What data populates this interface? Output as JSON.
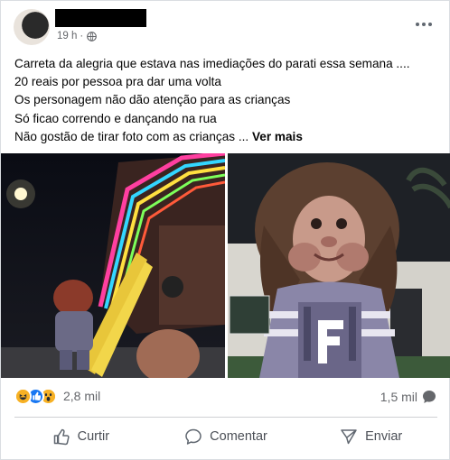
{
  "post": {
    "author_name": "",
    "timestamp": "19 h",
    "separator": "·",
    "privacy_icon": "globe-icon",
    "menu_icon": "more-horizontal-icon",
    "lines": [
      "Carreta da alegria que estava nas imediações do parati essa semana ....",
      "20 reais por pessoa pra dar uma volta",
      "Os personagem não dão atenção para as crianças",
      "Só ficao correndo e dançando na rua",
      "Não gostão de tirar foto com as crianças ..."
    ],
    "see_more": "Ver mais"
  },
  "photos": [
    {
      "name": "photo-left",
      "description_icon": "carnival-truck-photo"
    },
    {
      "name": "photo-right",
      "description_icon": "costume-character-photo"
    }
  ],
  "stats": {
    "reaction_icons": [
      "haha-icon",
      "like-icon",
      "wow-icon"
    ],
    "reaction_count": "2,8 mil",
    "comment_count": "1,5 mil",
    "comment_icon": "comment-bubble-icon"
  },
  "actions": [
    {
      "label": "Curtir",
      "icon": "thumbs-up-icon"
    },
    {
      "label": "Comentar",
      "icon": "comment-icon"
    },
    {
      "label": "Enviar",
      "icon": "send-icon"
    }
  ],
  "colors": {
    "secondary_text": "#65676b",
    "like_blue": "#1877f2",
    "reaction_yellow": "#f7b125",
    "divider": "#ced0d4"
  }
}
